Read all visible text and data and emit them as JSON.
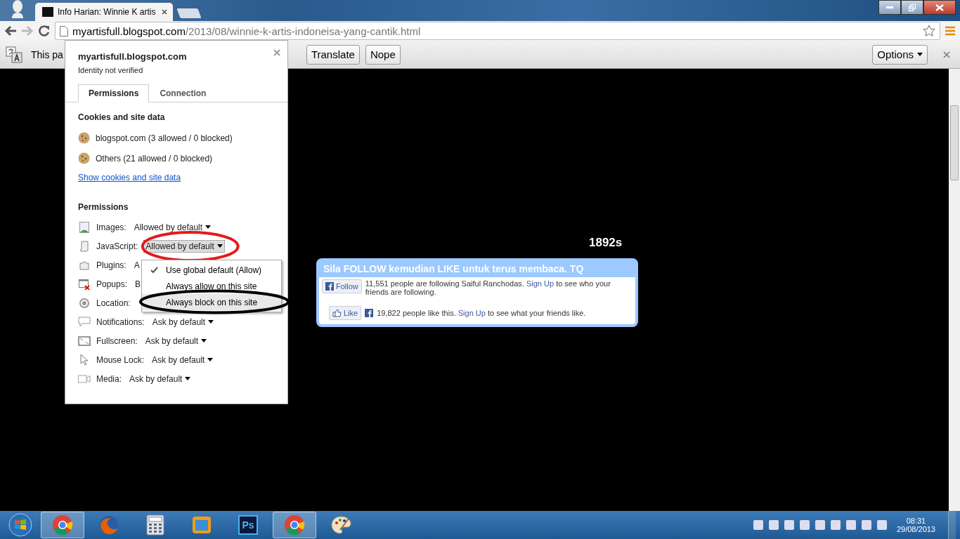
{
  "browser_tab": {
    "title": "Info Harian: Winnie K artis",
    "selected": true
  },
  "address_bar": {
    "host": "myartisfull.blogspot.com",
    "path": "/2013/08/winnie-k-artis-indoneisa-yang-cantik.html"
  },
  "translate_bar": {
    "message": "This pa",
    "buttons": [
      "Translate",
      "Nope"
    ],
    "options": "Options"
  },
  "site_info": {
    "host": "myartisfull.blogspot.com",
    "identity": "Identity not verified",
    "tabs": [
      {
        "label": "Permissions",
        "selected": true
      },
      {
        "label": "Connection",
        "selected": false
      }
    ],
    "cookies_heading": "Cookies and site data",
    "cookies": [
      "blogspot.com (3 allowed / 0 blocked)",
      "Others (21 allowed / 0 blocked)"
    ],
    "cookies_link": "Show cookies and site data",
    "permissions_heading": "Permissions",
    "permissions": [
      {
        "kind": "images",
        "label": "Images:",
        "value": "Allowed by default"
      },
      {
        "kind": "javascript",
        "label": "JavaScript:",
        "value": "Allowed by default",
        "open": true
      },
      {
        "kind": "plugins",
        "label": "Plugins:",
        "value": "A"
      },
      {
        "kind": "popups",
        "label": "Popups:",
        "value": "B"
      },
      {
        "kind": "location",
        "label": "Location:"
      },
      {
        "kind": "notifications",
        "label": "Notifications:",
        "value": "Ask by default"
      },
      {
        "kind": "fullscreen",
        "label": "Fullscreen:",
        "value": "Ask by default"
      },
      {
        "kind": "mouselock",
        "label": "Mouse Lock:",
        "value": "Ask by default"
      },
      {
        "kind": "media",
        "label": "Media:",
        "value": "Ask by default"
      }
    ]
  },
  "permission_menu": {
    "items": [
      {
        "label": "Use global default (Allow)",
        "checked": true,
        "highlighted": false
      },
      {
        "label": "Always allow on this site",
        "checked": false,
        "highlighted": false
      },
      {
        "label": "Always block on this site",
        "checked": false,
        "highlighted": true
      }
    ]
  },
  "page": {
    "counter": "1892s",
    "widget": {
      "title": "Sila FOLLOW kemudian LIKE untuk terus membaca. TQ",
      "follow_button": "Follow",
      "follow_text": "11,551 people are following Saiful Ranchodas.",
      "follow_link": "Sign Up",
      "follow_rest": "to see who your friends are following.",
      "like_button": "Like",
      "like_text": "19,822 people like this.",
      "like_link": "Sign Up",
      "like_rest": "to see what your friends like."
    }
  },
  "taskbar": {
    "apps": [
      {
        "kind": "chrome",
        "running": true
      },
      {
        "kind": "firefox",
        "running": false
      },
      {
        "kind": "calculator",
        "running": false
      },
      {
        "kind": "folder",
        "running": false
      },
      {
        "kind": "photoshop",
        "label": "Ps",
        "running": false
      },
      {
        "kind": "chrome",
        "running": true
      },
      {
        "kind": "paint",
        "running": false
      }
    ],
    "time": "08:31",
    "date": "29/08/2013"
  }
}
